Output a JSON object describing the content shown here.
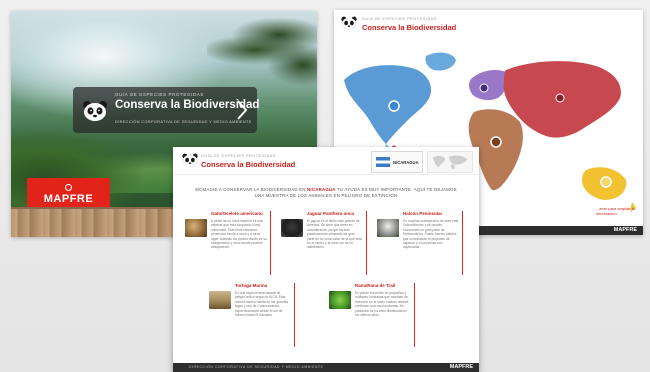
{
  "cover": {
    "kicker": "GUÍA DE ESPECIES PROTEGIDAS",
    "title": "Conserva la Biodiversidad",
    "subtitle": "DIRECCIÓN CORPORATIVA DE SEGURIDAD Y MEDIO AMBIENTE",
    "logo": "MAPFRE",
    "icon": "panda-icon"
  },
  "map_page": {
    "kicker": "GUÍA DE ESPECIES PROTEGIDAS",
    "title": "Conserva la Biodiversidad",
    "caption": "...ento para ampliar la información",
    "footer_brand": "MAPFRE",
    "colors": {
      "north_america": "#5b9bd5",
      "south_america": "#5aa84a",
      "europe": "#9a78c8",
      "asia": "#c8484f",
      "africa": "#b77a55",
      "oceania": "#f2c230"
    }
  },
  "species_page": {
    "kicker": "GUÍA DE ESPECIES PROTEGIDAS",
    "title": "Conserva la Biodiversidad",
    "country": "NICARAGUA",
    "intro_prefix": "MCMAGIE A CONSERVAR LA BIODIVERSIDAD EN",
    "intro_highlight": "NICARAGUA",
    "intro_suffix": "TU AYUDA ES MUY IMPORTANTE. AQUÍ TE DEJAMOS UNA MUESTRA DE LOS ANIMALES EN PELIGRO DE EXTINCIÓN",
    "species": [
      {
        "name": "Gato/Ocelote americano",
        "desc": "A pesar de su línea superior es una especie que está ocupando como vulnerable. Éste lleva vicinanza protección frente a otros y a otros lugar. Además los puntos donde es su desaparición y otros donde pudiera desaparecer."
      },
      {
        "name": "Jaguar Panthera onca",
        "desc": "El jaguar es el felino más grande de América. Se tiene que tener en consideración ya que ha sido prácticamente eliminado de gran parte de su zona salvo de la que está en el centro y la zona sur de su distribución."
      },
      {
        "name": "Halcón Peninsular",
        "desc": "En muchas subespecies de aves este Falconiformes y es posible encontrarlo en gran parte de Norteamérica. Posee fuertes hábitos que complicarán el propósito de capturar y a los presas son capturadas."
      },
      {
        "name": "Tortuga Marina",
        "desc": "Es una especie amenazada de peligro crítico según la IUCN. Esta animal marino habita en los grandes lagos y ríos de Centroamérica, específicamente desde el sur de México hasta El Salvador."
      },
      {
        "name": "Rana/Rana de Trail",
        "desc": "Es puede encontrar en pequeñas y múltiples hondadas que cambian de dirección en el suelo cuando delante contienen una mucha plantas. Su población se ha visto disminuida en los últimos años."
      }
    ],
    "footer_org": "DIRECCIÓN CORPORATIVA DE SEGURIDAD Y MEDIO AMBIENTE",
    "footer_brand": "MAPFRE"
  }
}
